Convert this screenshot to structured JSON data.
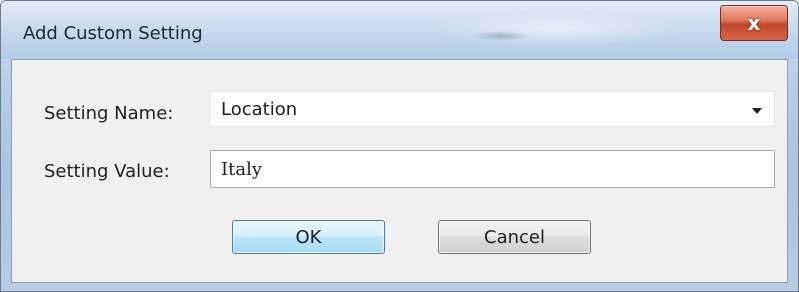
{
  "window": {
    "title": "Add Custom Setting",
    "close_label": "x"
  },
  "form": {
    "setting_name": {
      "label": "Setting Name:",
      "value": "Location"
    },
    "setting_value": {
      "label": "Setting Value:",
      "value": "Italy"
    }
  },
  "buttons": {
    "ok_label": "OK",
    "cancel_label": "Cancel"
  },
  "icons": {
    "close": "close-icon",
    "dropdown": "chevron-down-icon"
  },
  "colors": {
    "close_button": "#c2462b",
    "ok_border": "#3c7fb1",
    "client_bg": "#f0f0f0"
  }
}
